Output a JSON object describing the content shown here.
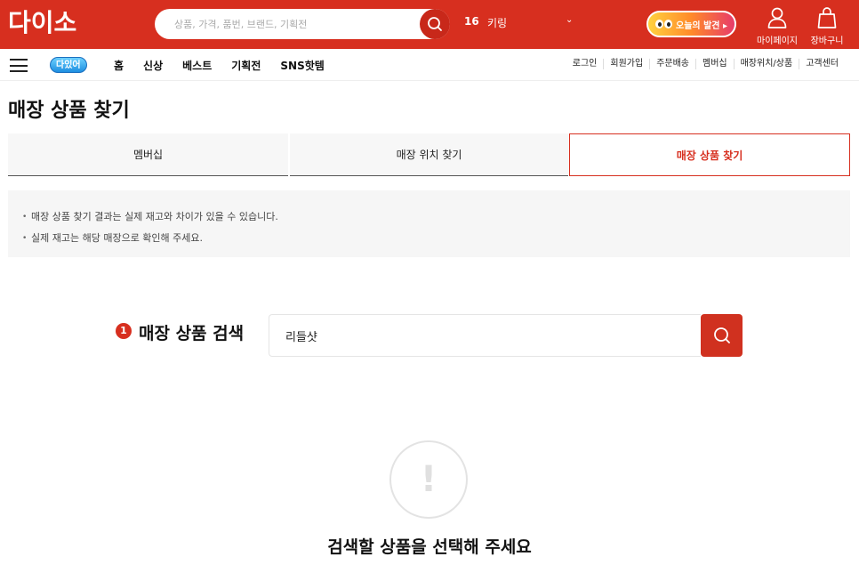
{
  "header": {
    "logo_text": "다이소",
    "search_placeholder": "상품, 가격, 품번, 브랜드, 기획전",
    "rank_number": "16",
    "rank_keyword": "키링",
    "rank_toggle": "⌄",
    "today_label": "오늘의 발견 ▸",
    "mypage_label": "마이페이지",
    "cart_label": "장바구니",
    "brand_color": "#d72f1f"
  },
  "nav": {
    "badge_text": "다있어",
    "main_items": [
      "홈",
      "신상",
      "베스트",
      "기획전",
      "SNS핫템"
    ],
    "util_items": [
      "로그인",
      "회원가입",
      "주문배송",
      "멤버십",
      "매장위치/상품",
      "고객센터"
    ]
  },
  "page": {
    "title": "매장 상품 찾기",
    "tabs": [
      "멤버십",
      "매장 위치 찾기",
      "매장 상품 찾기"
    ],
    "active_tab": "매장 상품 찾기",
    "notices": [
      "매장 상품 찾기 결과는 실제 재고와 차이가 있을 수 있습니다.",
      "실제 재고는 해당 매장으로 확인해 주세요."
    ]
  },
  "search_section": {
    "step": "1",
    "title": "매장 상품 검색",
    "input_value": "리들샷"
  },
  "empty_state": {
    "icon_glyph": "!",
    "message": "검색할 상품을 선택해 주세요"
  }
}
